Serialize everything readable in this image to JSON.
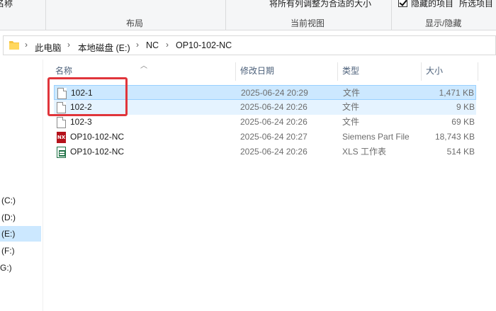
{
  "ribbon": {
    "left_cut_text": "项目名称",
    "mid_cut_text": "将所有列调整为合适的大小",
    "hidden_items_label": "隐藏的项目",
    "selected_items_label": "所选项目",
    "groups": [
      "布局",
      "当前视图",
      "显示/隐藏"
    ]
  },
  "breadcrumb": [
    "此电脑",
    "本地磁盘 (E:)",
    "NC",
    "OP10-102-NC"
  ],
  "nav": {
    "items": [
      {
        "label": "(C:)",
        "selected": false
      },
      {
        "label": "(D:)",
        "selected": false
      },
      {
        "label": "(E:)",
        "selected": true
      },
      {
        "label": "(F:)",
        "selected": false
      },
      {
        "label": "G:)",
        "selected": false
      }
    ]
  },
  "columns": {
    "name": "名称",
    "date": "修改日期",
    "type": "类型",
    "size": "大小"
  },
  "files": [
    {
      "name": "102-1",
      "date": "2025-06-24 20:29",
      "type": "文件",
      "size": "1,471 KB",
      "icon": "blank-file-icon",
      "state": "selected"
    },
    {
      "name": "102-2",
      "date": "2025-06-24 20:26",
      "type": "文件",
      "size": "9 KB",
      "icon": "blank-file-icon",
      "state": "hover"
    },
    {
      "name": "102-3",
      "date": "2025-06-24 20:26",
      "type": "文件",
      "size": "69 KB",
      "icon": "blank-file-icon",
      "state": "none"
    },
    {
      "name": "OP10-102-NC",
      "date": "2025-06-24 20:27",
      "type": "Siemens Part File",
      "size": "18,743 KB",
      "icon": "nx-part-icon",
      "state": "none"
    },
    {
      "name": "OP10-102-NC",
      "date": "2025-06-24 20:26",
      "type": "XLS 工作表",
      "size": "514 KB",
      "icon": "xls-icon",
      "state": "none"
    }
  ],
  "nx_icon_text": "NX",
  "colors": {
    "selection": "#cce8ff",
    "highlight_box": "#e0353b",
    "folder": "#f5c441"
  }
}
